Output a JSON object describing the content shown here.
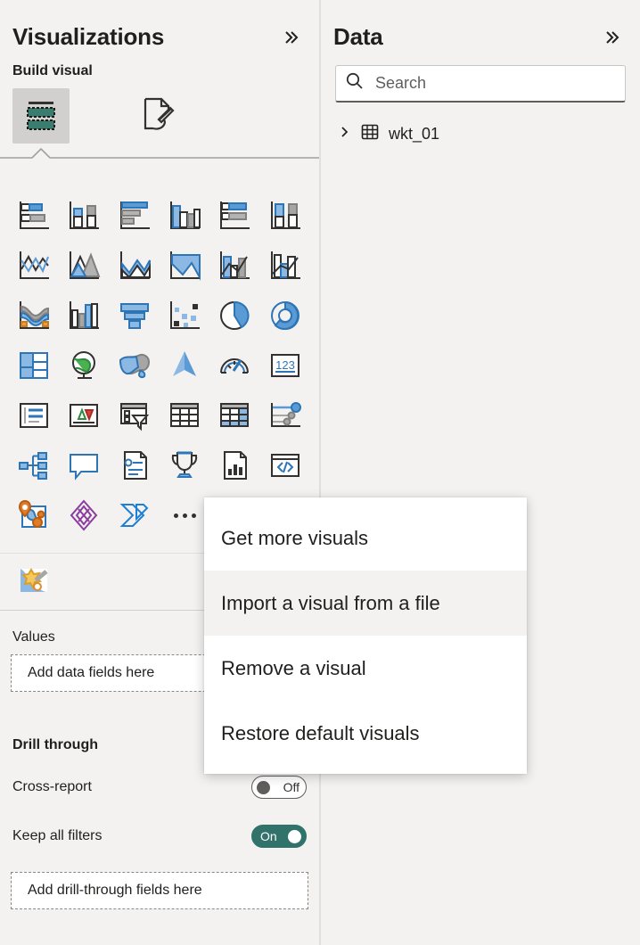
{
  "colors": {
    "panel_bg": "#f3f2f1",
    "accent_blue": "#5b9bd5",
    "accent_blue_dark": "#2e75b6",
    "teal": "#31726a",
    "gray": "#a6a6a6",
    "outline": "#323130"
  },
  "visualizations_panel": {
    "title": "Visualizations",
    "collapse_icon": "double-chevron-right-icon",
    "section_label": "Build visual",
    "tabs": [
      {
        "name": "build-visual-tab",
        "icon": "fields-table-icon",
        "selected": true
      },
      {
        "name": "format-visual-tab",
        "icon": "paintbrush-page-icon",
        "selected": false
      }
    ],
    "gallery": [
      {
        "name": "stacked-bar-chart",
        "icon": "stacked-bar-chart-icon"
      },
      {
        "name": "stacked-column-chart",
        "icon": "stacked-column-chart-icon"
      },
      {
        "name": "clustered-bar-chart",
        "icon": "clustered-bar-chart-icon"
      },
      {
        "name": "clustered-column-chart",
        "icon": "clustered-column-chart-icon"
      },
      {
        "name": "100-stacked-bar-chart",
        "icon": "pct-stacked-bar-chart-icon"
      },
      {
        "name": "100-stacked-column-chart",
        "icon": "pct-stacked-column-chart-icon"
      },
      {
        "name": "line-chart",
        "icon": "line-chart-icon"
      },
      {
        "name": "area-chart",
        "icon": "area-chart-icon"
      },
      {
        "name": "stacked-area-chart",
        "icon": "stacked-area-chart-icon"
      },
      {
        "name": "line-and-stacked-column-chart",
        "icon": "filled-area-chart-icon"
      },
      {
        "name": "line-and-clustered-column-chart",
        "icon": "line-stacked-column-icon"
      },
      {
        "name": "line-and-clustered-column-chart-2",
        "icon": "line-clustered-column-icon"
      },
      {
        "name": "ribbon-chart",
        "icon": "ribbon-chart-icon"
      },
      {
        "name": "waterfall-chart",
        "icon": "waterfall-chart-icon"
      },
      {
        "name": "funnel-chart",
        "icon": "funnel-chart-icon"
      },
      {
        "name": "scatter-chart",
        "icon": "scatter-chart-icon"
      },
      {
        "name": "pie-chart",
        "icon": "pie-chart-icon"
      },
      {
        "name": "donut-chart",
        "icon": "donut-chart-icon"
      },
      {
        "name": "treemap",
        "icon": "treemap-icon"
      },
      {
        "name": "map",
        "icon": "globe-map-icon"
      },
      {
        "name": "filled-map",
        "icon": "filled-map-icon"
      },
      {
        "name": "azure-map",
        "icon": "azure-map-arrow-icon"
      },
      {
        "name": "gauge",
        "icon": "gauge-icon"
      },
      {
        "name": "card",
        "icon": "card-123-icon"
      },
      {
        "name": "multi-row-card",
        "icon": "multi-row-card-icon"
      },
      {
        "name": "kpi",
        "icon": "kpi-triangles-icon"
      },
      {
        "name": "slicer",
        "icon": "slicer-funnel-icon"
      },
      {
        "name": "table",
        "icon": "table-grid-icon"
      },
      {
        "name": "matrix",
        "icon": "matrix-grid-icon"
      },
      {
        "name": "r-script-visual",
        "icon": "dot-plot-icon"
      },
      {
        "name": "decomposition-tree",
        "icon": "decomposition-tree-icon"
      },
      {
        "name": "q-and-a",
        "icon": "speech-bubble-icon"
      },
      {
        "name": "smart-narrative",
        "icon": "narrative-document-icon"
      },
      {
        "name": "key-influencers",
        "icon": "trophy-icon"
      },
      {
        "name": "paginated-report",
        "icon": "report-page-chart-icon"
      },
      {
        "name": "python-visual",
        "icon": "code-window-icon"
      },
      {
        "name": "arcgis-maps",
        "icon": "arcgis-map-pin-icon"
      },
      {
        "name": "power-apps",
        "icon": "power-apps-diamond-icon"
      },
      {
        "name": "power-automate",
        "icon": "power-automate-arrow-icon"
      },
      {
        "name": "more-options",
        "icon": "ellipsis-icon"
      }
    ],
    "custom_visual": {
      "name": "custom-visual-spark",
      "icon": "custom-visual-burst-icon"
    },
    "wells": [
      {
        "label": "Values",
        "bold": false,
        "dropzone_text": "Add data fields here"
      }
    ],
    "drill_through": {
      "heading": "Drill through",
      "toggles": [
        {
          "label": "Cross-report",
          "state": "Off",
          "on": false
        },
        {
          "label": "Keep all filters",
          "state": "On",
          "on": true
        }
      ],
      "dropzone_text": "Add drill-through fields here"
    }
  },
  "context_menu": {
    "items": [
      {
        "label": "Get more visuals",
        "highlighted": false
      },
      {
        "label": "Import a visual from a file",
        "highlighted": true
      },
      {
        "label": "Remove a visual",
        "highlighted": false
      },
      {
        "label": "Restore default visuals",
        "highlighted": false
      }
    ]
  },
  "data_panel": {
    "title": "Data",
    "collapse_icon": "double-chevron-right-icon",
    "search": {
      "value": "",
      "placeholder": "Search",
      "icon": "search-icon"
    },
    "tree": [
      {
        "label": "wkt_01",
        "expand_icon": "chevron-right-icon",
        "table_icon": "table-icon",
        "expanded": false
      }
    ]
  }
}
